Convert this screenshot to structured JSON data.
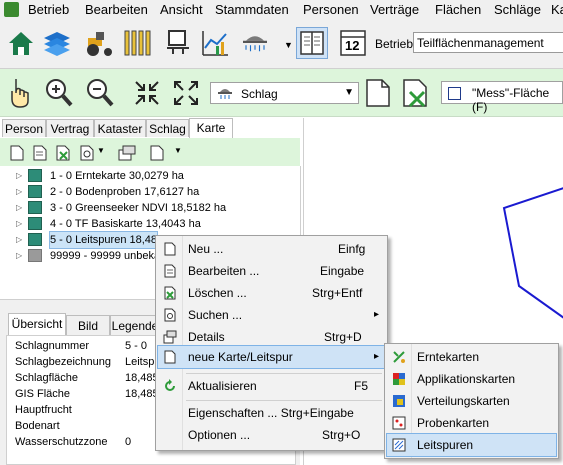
{
  "menubar": {
    "items": [
      "Betrieb",
      "Bearbeiten",
      "Ansicht",
      "Stammdaten",
      "Personen",
      "Verträge",
      "Flächen",
      "Schläge",
      "Ka"
    ]
  },
  "toolbar1": {
    "icons": [
      "home-icon",
      "layers-icon",
      "tractor-icon",
      "tubes-icon",
      "dolly-icon",
      "chart-icon",
      "sprayer-icon",
      "book-icon",
      "calendar-icon"
    ],
    "calendar_day": "12",
    "betrieb_label": "Betrieb",
    "betrieb_value": "Teilflächenmanagement"
  },
  "toolbar2": {
    "schlag_value": "Schlag",
    "mess_label": "\"Mess\"-Fläche (F)"
  },
  "left_tabs": [
    "Person",
    "Vertrag",
    "Kataster",
    "Schlag",
    "Karte"
  ],
  "active_tab": "Karte",
  "tree": [
    {
      "label": "1 - 0 Erntekarte 30,0279 ha"
    },
    {
      "label": "2 - 0 Bodenproben 17,6127 ha"
    },
    {
      "label": "3 - 0 Greenseeker NDVI 18,5182 ha"
    },
    {
      "label": "4 - 0 TF Basiskarte 13,4043 ha"
    },
    {
      "label": "5 - 0 Leitspuren 18,48"
    },
    {
      "label": "99999 - 99999 unbeka"
    }
  ],
  "detail_tabs": [
    "Übersicht",
    "Bild",
    "Legende"
  ],
  "properties": [
    {
      "name": "Schlagnummer",
      "value": "5 - 0"
    },
    {
      "name": "Schlagbezeichnung",
      "value": "Leitspu"
    },
    {
      "name": "Schlagfläche",
      "value": "18,485"
    },
    {
      "name": "GIS Fläche",
      "value": "18,485"
    },
    {
      "name": "Hauptfrucht",
      "value": ""
    },
    {
      "name": "Bodenart",
      "value": ""
    },
    {
      "name": "Wasserschutzzone",
      "value": "0"
    }
  ],
  "context_menu": {
    "items": [
      {
        "label": "Neu ...",
        "shortcut": "Einfg"
      },
      {
        "label": "Bearbeiten ...",
        "shortcut": "Eingabe"
      },
      {
        "label": "Löschen ...",
        "shortcut": "Strg+Entf"
      },
      {
        "label": "Suchen ...",
        "shortcut": "▸"
      },
      {
        "label": "Details",
        "shortcut": "Strg+D"
      },
      {
        "label": "neue Karte/Leitspur",
        "shortcut": "▸"
      },
      {
        "label": "Aktualisieren",
        "shortcut": "F5"
      },
      {
        "label": "Eigenschaften ... Strg+Eingabe",
        "shortcut": ""
      },
      {
        "label": "Optionen ...",
        "shortcut": "Strg+O"
      }
    ]
  },
  "submenu": {
    "items": [
      {
        "label": "Erntekarten"
      },
      {
        "label": "Applikationskarten"
      },
      {
        "label": "Verteilungskarten"
      },
      {
        "label": "Probenkarten"
      },
      {
        "label": "Leitspuren"
      }
    ]
  },
  "colors": {
    "toolbar_green": "#ddf5db",
    "highlight": "#cfe3f6",
    "map_line": "#1a1ad0"
  }
}
